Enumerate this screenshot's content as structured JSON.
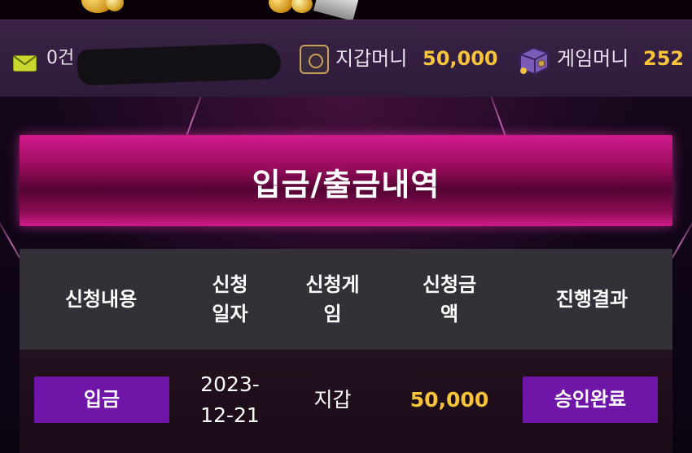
{
  "header": {
    "mail_count": "0건",
    "wallet_label": "지갑머니",
    "wallet_value": "50,000",
    "game_label": "게임머니",
    "game_value": "252"
  },
  "icons": {
    "mail": "mail-icon",
    "wallet": "safe-icon",
    "game": "treasure-chest-icon"
  },
  "page": {
    "title": "입금/출금내역"
  },
  "table": {
    "columns": [
      "신청내용",
      "신청\n일자",
      "신청게\n임",
      "신청금\n액",
      "진행결과"
    ],
    "rows": [
      {
        "type": "입금",
        "date": "2023-\n12-21",
        "game": "지갑",
        "amount": "50,000",
        "status": "승인완료"
      }
    ]
  },
  "colors": {
    "accent_gold": "#f8c43a",
    "button_purple": "#6f16a8",
    "banner_pink": "#d11a8c"
  }
}
